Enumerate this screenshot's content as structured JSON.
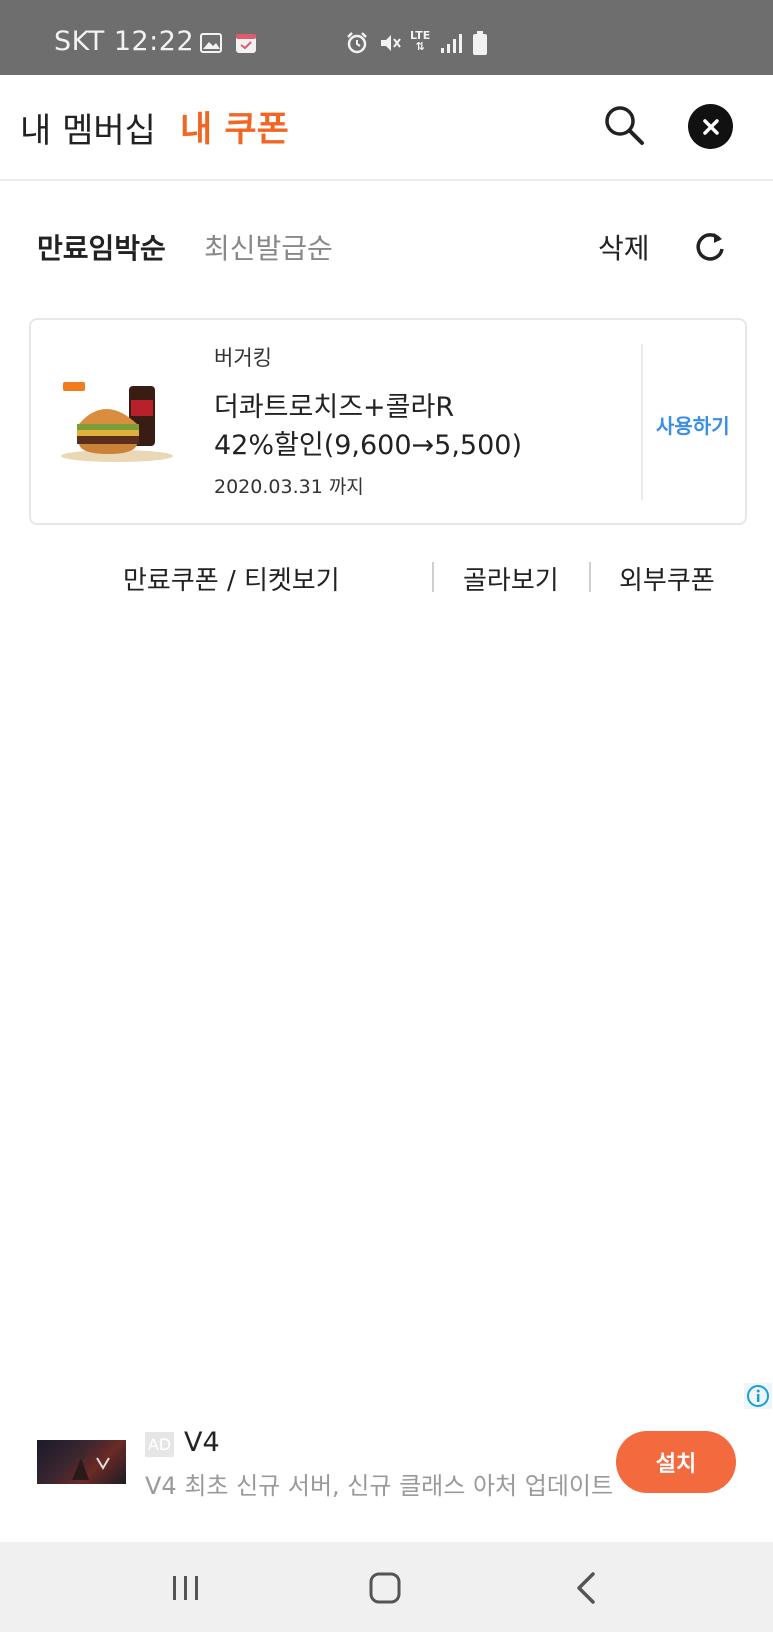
{
  "status_bar": {
    "carrier_time": "SKT 12:22",
    "icons": [
      "gallery-icon",
      "calendar-icon",
      "alarm-icon",
      "mute-icon",
      "lte-icon",
      "signal-icon",
      "battery-icon"
    ],
    "lte_label": "LTE"
  },
  "header": {
    "title_plain": "내 멤버십",
    "title_accent": "내 쿠폰",
    "accent_color": "#f26522",
    "search_icon": "search-icon",
    "close_icon": "close-icon"
  },
  "sort": {
    "option_active": "만료임박순",
    "option_inactive": "최신발급순",
    "delete_label": "삭제",
    "refresh_icon": "refresh-icon"
  },
  "coupons": [
    {
      "thumbnail": "burger-combo-image",
      "brand": "버거킹",
      "line1": "더콰트로치즈+콜라R",
      "line2": "42%할인(9,600→5,500)",
      "expiry": "2020.03.31 까지",
      "action": "사용하기",
      "action_color": "#3b8ee6"
    }
  ],
  "footer_links": {
    "expired": "만료쿠폰 / 티켓보기",
    "browse": "골라보기",
    "external": "외부쿠폰"
  },
  "ad": {
    "badge": "AD",
    "title": "V4",
    "description": "V4 최초 신규 서버, 신규 클래스 아처 업데이트",
    "install": "설치",
    "install_color": "#f46a3f"
  },
  "nav_bar": {
    "buttons": [
      "recent-apps-icon",
      "home-icon",
      "back-icon"
    ]
  }
}
